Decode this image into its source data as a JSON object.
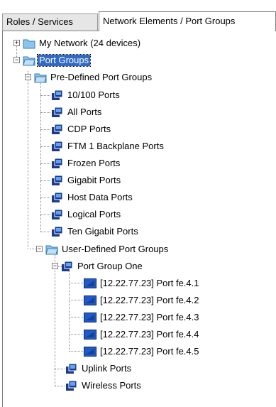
{
  "tabs": [
    {
      "label": "Roles / Services",
      "active": false
    },
    {
      "label": "Network Elements / Port Groups",
      "active": true
    }
  ],
  "tree": {
    "my_network": "My Network (24 devices)",
    "port_groups": "Port Groups",
    "predefined": {
      "label": "Pre-Defined Port Groups",
      "items": [
        "10/100 Ports",
        "All Ports",
        "CDP Ports",
        "FTM 1 Backplane Ports",
        "Frozen Ports",
        "Gigabit Ports",
        "Host Data Ports",
        "Logical Ports",
        "Ten Gigabit Ports"
      ]
    },
    "userdefined": {
      "label": "User-Defined Port Groups",
      "group_one": {
        "label": "Port Group One",
        "ports": [
          "[12.22.77.23] Port fe.4.1",
          "[12.22.77.23] Port fe.4.2",
          "[12.22.77.23] Port fe.4.3",
          "[12.22.77.23] Port fe.4.4",
          "[12.22.77.23] Port fe.4.5"
        ]
      },
      "others": [
        "Uplink Ports",
        "Wireless Ports"
      ]
    }
  },
  "colors": {
    "selection": "#316ac5",
    "folder": "#8fc4ea",
    "port_group_icon": "#1a3a8c",
    "port_icon": "#1e5ac8"
  },
  "icons": {
    "expander_open": "−",
    "expander_closed": "+"
  }
}
